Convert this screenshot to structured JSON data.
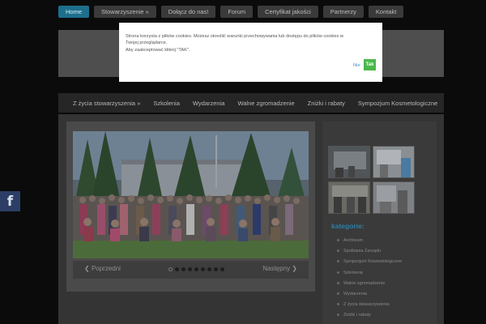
{
  "top_nav": [
    "Home",
    "Stowarzyszenie »",
    "Dołącz do nas!",
    "Forum",
    "Certyfikat jakości",
    "Partnerzy",
    "Kontakt"
  ],
  "main_nav": [
    "Z życia stowarzyszenia »",
    "Szkolenia",
    "Wydarzenia",
    "Walne zgromadzenie",
    "Zniżki i rabaty",
    "Sympozjum Kosmetologiczne"
  ],
  "slider": {
    "prev": "Poprzedni",
    "next": "Następny",
    "slide_count": 9,
    "current_slide": 1
  },
  "sidebar": {
    "categories_title": "kategorie:",
    "categories": [
      "Archiwum",
      "Spotkania Zarządu",
      "Sympozjum Kosmetologiczne",
      "Szkolenia",
      "Walne zgromadzenie",
      "Wydarzenia",
      "Z życia stowarzyszenia",
      "Zniżki i rabaty"
    ]
  },
  "social": {
    "facebook_glyph": "f"
  },
  "cookie_notice": {
    "line1": "Strona korzysta z plików cookies. Możesz określić warunki przechowywania lub dostępu do plików cookies w",
    "line2": "Twojej przeglądarce.",
    "line3": "Aby zaakceptować kliknij \"TAK\".",
    "no_label": "Nie",
    "yes_label": "Tak"
  },
  "colors": {
    "accent": "#1d6f8c",
    "accept": "#49b84a",
    "category_title": "#2f7fa8"
  }
}
